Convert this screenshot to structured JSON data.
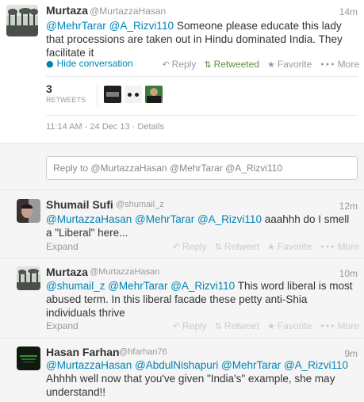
{
  "expanded_tweet": {
    "name": "Murtaza",
    "handle": "@MurtazzaHasan",
    "time": "14m",
    "mentions": [
      "@MehrTarar",
      "@A_Rizvi110"
    ],
    "text": "Someone please educate this lady that processions are taken out in Hindu dominated India. They facilitate it",
    "hide_label": "Hide conversation",
    "reply_label": "Reply",
    "retweeted_label": "Retweeted",
    "favorite_label": "Favorite",
    "more_label": "More",
    "retweet_count": "3",
    "retweets_label": "RETWEETS",
    "timestamp": "11:14 AM - 24 Dec 13",
    "details_label": "Details"
  },
  "reply_box": {
    "placeholder": "Reply to @MurtazzaHasan @MehrTarar @A_Rizvi110"
  },
  "replies": [
    {
      "name": "Shumail Sufi",
      "handle": "@shumail_z",
      "time": "12m",
      "mentions": "@MurtazzaHasan @MehrTarar @A_Rizvi110",
      "text": "aaahhh do I smell a \"Liberal\" here...",
      "expand": "Expand"
    },
    {
      "name": "Murtaza",
      "handle": "@MurtazzaHasan",
      "time": "10m",
      "mentions": "@shumail_z @MehrTarar @A_Rizvi110",
      "text": "This word liberal is most abused term. In this liberal facade these petty anti-Shia individuals thrive",
      "expand": "Expand"
    },
    {
      "name": "Hasan Farhan",
      "handle": "@hfarhan76",
      "time": "9m",
      "mentions": "@MurtazzaHasan @AbdulNishapuri @MehrTarar @A_Rizvi110",
      "text": "Ahhhh well now that you've given \"India's\" example, she may understand!!"
    }
  ],
  "action_labels": {
    "reply": "Reply",
    "retweet": "Retweet",
    "favorite": "Favorite",
    "more": "More"
  },
  "colors": {
    "link": "#0084b4",
    "retweeted": "#5c913b",
    "reply_bg": "#f5f5f5"
  }
}
